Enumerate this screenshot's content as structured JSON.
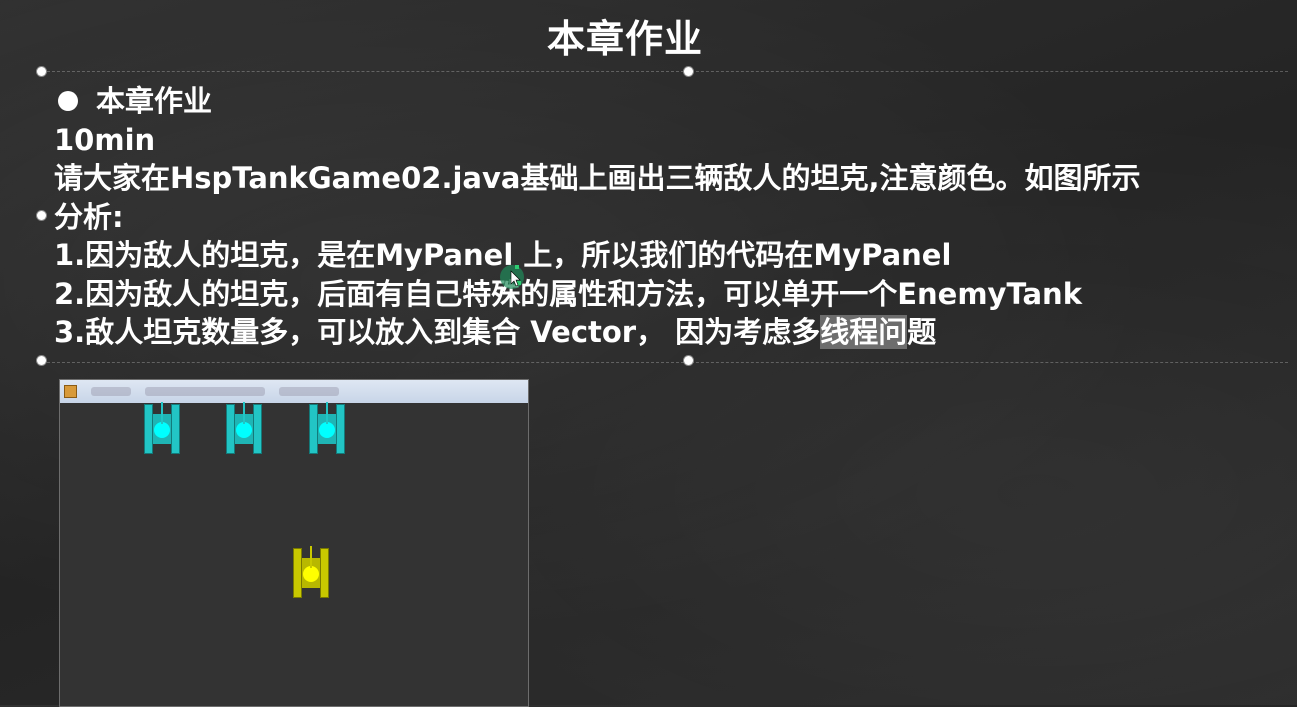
{
  "slide": {
    "title": "本章作业",
    "heading": "本章作业",
    "lines": [
      "10min",
      "请大家在HspTankGame02.java基础上画出三辆敌人的坦克,注意颜色。如图所示",
      "分析:",
      "1.因为敌人的坦克，是在MyPanel 上，所以我们的代码在MyPanel",
      "2.因为敌人的坦克，后面有自己特殊的属性和方法，可以单开一个EnemyTank"
    ],
    "line6_pre": "3.敌人坦克数量多，可以放入到集合  Vector，  因为考虑多",
    "line6_highlight": "线程问",
    "line6_post": "题"
  },
  "game": {
    "background": "#333333",
    "enemy_color": "#22c5c5",
    "enemy_turret_color": "#00ffff",
    "player_color": "#c8c800",
    "player_turret_color": "#ffff00",
    "enemy_tank_count": 3,
    "player_tank_count": 1
  }
}
